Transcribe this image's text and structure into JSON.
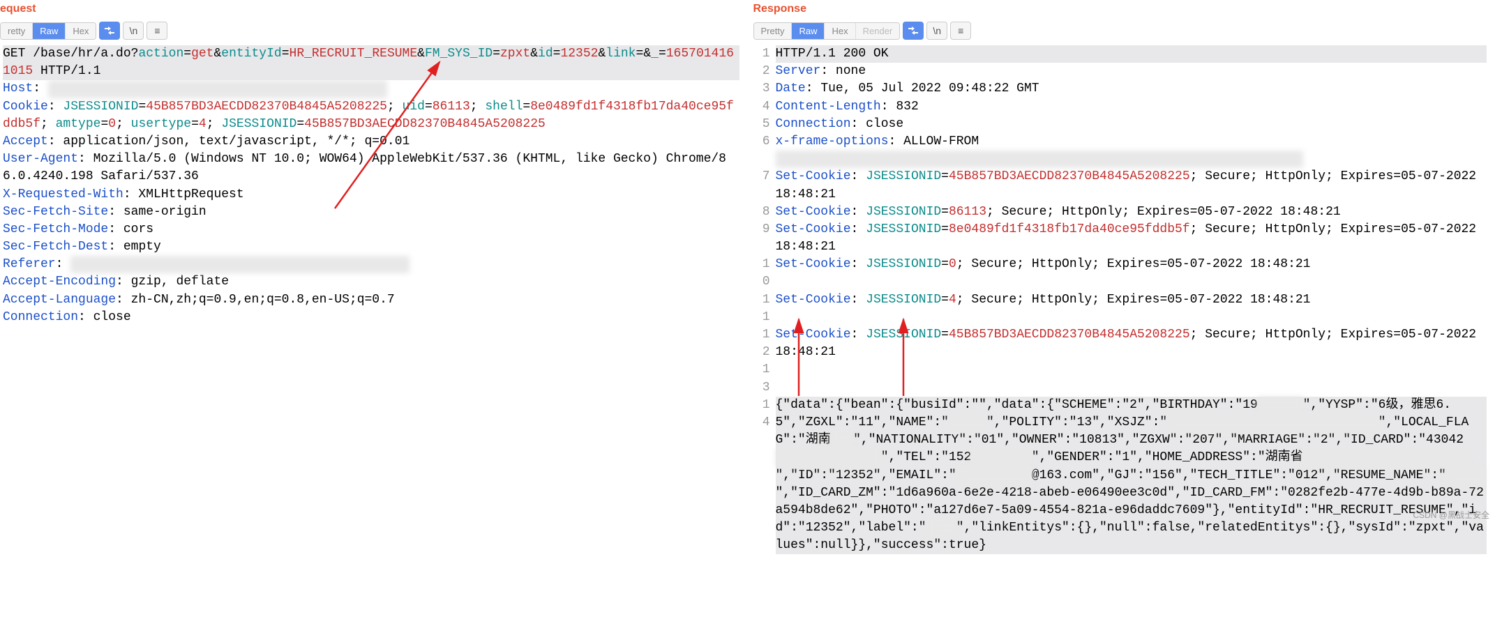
{
  "left": {
    "title": "equest",
    "tabs": [
      "retty",
      "Raw",
      "Hex"
    ],
    "activeTab": 1,
    "iconButtons": [
      "format",
      "newline",
      "menu"
    ],
    "request": {
      "method": "GET",
      "path": "/base/hr/a.do",
      "qmark": "?",
      "params": [
        {
          "k": "action",
          "v": "get"
        },
        {
          "k": "entityId",
          "v": "HR_RECRUIT_RESUME"
        },
        {
          "k": "FM_SYS_ID",
          "v": "zpxt"
        },
        {
          "k": "id",
          "v": "12352"
        },
        {
          "k": "link",
          "v": ""
        },
        {
          "k": "_",
          "v": "1657014161015"
        }
      ],
      "protocol": "HTTP/1.1",
      "headers": [
        {
          "name": "Host",
          "value": "",
          "redacted": true
        },
        {
          "name": "Cookie",
          "cookiePairs": [
            {
              "k": "JSESSIONID",
              "v": "45B857BD3AECDD82370B4845A5208225"
            },
            {
              "k": "uid",
              "v": "86113"
            },
            {
              "k": "shell",
              "v": "8e0489fd1f4318fb17da40ce95fddb5f"
            },
            {
              "k": "amtype",
              "v": "0"
            },
            {
              "k": "usertype",
              "v": "4"
            },
            {
              "k": "JSESSIONID",
              "v": "45B857BD3AECDD82370B4845A5208225"
            }
          ]
        },
        {
          "name": "Accept",
          "value": "application/json, text/javascript, */*; q=0.01"
        },
        {
          "name": "User-Agent",
          "value": "Mozilla/5.0 (Windows NT 10.0; WOW64) AppleWebKit/537.36 (KHTML, like Gecko) Chrome/86.0.4240.198 Safari/537.36"
        },
        {
          "name": "X-Requested-With",
          "value": "XMLHttpRequest"
        },
        {
          "name": "Sec-Fetch-Site",
          "value": "same-origin"
        },
        {
          "name": "Sec-Fetch-Mode",
          "value": "cors"
        },
        {
          "name": "Sec-Fetch-Dest",
          "value": "empty"
        },
        {
          "name": "Referer",
          "value": "",
          "redacted": true
        },
        {
          "name": "Accept-Encoding",
          "value": "gzip, deflate"
        },
        {
          "name": "Accept-Language",
          "value": "zh-CN,zh;q=0.9,en;q=0.8,en-US;q=0.7"
        },
        {
          "name": "Connection",
          "value": "close"
        }
      ]
    }
  },
  "right": {
    "title": "Response",
    "tabs": [
      "Pretty",
      "Raw",
      "Hex",
      "Render"
    ],
    "activeTab": 1,
    "iconButtons": [
      "format",
      "newline",
      "menu"
    ],
    "lines": [
      {
        "n": 1,
        "segments": [
          {
            "t": "HTTP/1.1 200 OK"
          }
        ],
        "hl": true
      },
      {
        "n": 2,
        "segments": [
          {
            "t": "Server",
            "c": "blue"
          },
          {
            "t": ": none"
          }
        ]
      },
      {
        "n": 3,
        "segments": [
          {
            "t": "Date",
            "c": "blue"
          },
          {
            "t": ": Tue, 05 Jul 2022 09:48:22 GMT"
          }
        ]
      },
      {
        "n": 4,
        "segments": [
          {
            "t": "Content-Length",
            "c": "blue"
          },
          {
            "t": ": 832"
          }
        ]
      },
      {
        "n": 5,
        "segments": [
          {
            "t": "Connection",
            "c": "blue"
          },
          {
            "t": ": close"
          }
        ]
      },
      {
        "n": 6,
        "segments": [
          {
            "t": "x-frame-options",
            "c": "blue"
          },
          {
            "t": ": ALLOW-FROM "
          },
          {
            "t": "xxxxxxxxxxxxxxxxxxxxxxxxxxxxxxxxxxxxxxxxxxxxxxxxxxxxxxxxxxxxxxxxxxxxxx",
            "redact": true
          }
        ]
      },
      {
        "n": 7,
        "segments": [
          {
            "t": "Set-Cookie",
            "c": "blue"
          },
          {
            "t": ": "
          },
          {
            "t": "JSESSIONID",
            "c": "teal"
          },
          {
            "t": "="
          },
          {
            "t": "45B857BD3AECDD82370B4845A5208225",
            "c": "red"
          },
          {
            "t": "; Secure; HttpOnly; Expires=05-07-2022 18:48:21"
          }
        ]
      },
      {
        "n": 8,
        "segments": [
          {
            "t": "Set-Cookie",
            "c": "blue"
          },
          {
            "t": ": "
          },
          {
            "t": "JSESSIONID",
            "c": "teal"
          },
          {
            "t": "="
          },
          {
            "t": "86113",
            "c": "red"
          },
          {
            "t": "; Secure; HttpOnly; Expires=05-07-2022 18:48:21"
          }
        ]
      },
      {
        "n": 9,
        "segments": [
          {
            "t": "Set-Cookie",
            "c": "blue"
          },
          {
            "t": ": "
          },
          {
            "t": "JSESSIONID",
            "c": "teal"
          },
          {
            "t": "="
          },
          {
            "t": "8e0489fd1f4318fb17da40ce95fddb5f",
            "c": "red"
          },
          {
            "t": "; Secure; HttpOnly; Expires=05-07-2022 18:48:21"
          }
        ]
      },
      {
        "n": 10,
        "segments": [
          {
            "t": "Set-Cookie",
            "c": "blue"
          },
          {
            "t": ": "
          },
          {
            "t": "JSESSIONID",
            "c": "teal"
          },
          {
            "t": "="
          },
          {
            "t": "0",
            "c": "red"
          },
          {
            "t": "; Secure; HttpOnly; Expires=05-07-2022 18:48:21"
          }
        ]
      },
      {
        "n": 11,
        "segments": [
          {
            "t": "Set-Cookie",
            "c": "blue"
          },
          {
            "t": ": "
          },
          {
            "t": "JSESSIONID",
            "c": "teal"
          },
          {
            "t": "="
          },
          {
            "t": "4",
            "c": "red"
          },
          {
            "t": "; Secure; HttpOnly; Expires=05-07-2022 18:48:21"
          }
        ]
      },
      {
        "n": 12,
        "segments": [
          {
            "t": "Set-Cookie",
            "c": "blue"
          },
          {
            "t": ": "
          },
          {
            "t": "JSESSIONID",
            "c": "teal"
          },
          {
            "t": "="
          },
          {
            "t": "45B857BD3AECDD82370B4845A5208225",
            "c": "red"
          },
          {
            "t": "; Secure; HttpOnly; Expires=05-07-2022 18:48:21"
          }
        ]
      },
      {
        "n": 13,
        "segments": [
          {
            "t": ""
          }
        ]
      },
      {
        "n": 14,
        "segments": [
          {
            "t": "{\"data\":{\"bean\":{\"busiId\":\"\",\"data\":{\"SCHEME\":\"2\",\"BIRTHDAY\":\"19"
          },
          {
            "t": "xxxxxx",
            "redact": true
          },
          {
            "t": "\",\"YYSP\":\"6级，雅思6.5\",\"ZGXL\":\"11\",\"NAME\":\""
          },
          {
            "t": "xxxxx",
            "redact": true
          },
          {
            "t": "\",\"POLITY\":\"13\",\"XSJZ\":\""
          },
          {
            "t": "xxxxxxxxxxxxxxxxxxxxxxxxxxxx",
            "redact": true
          },
          {
            "t": "\",\"LOCAL_FLAG\":\"湖南"
          },
          {
            "t": "xxx",
            "redact": true
          },
          {
            "t": "\",\"NATIONALITY\":\"01\",\"OWNER\":\"10813\",\"ZGXW\":\"207\",\"MARRIAGE\":\"2\",\"ID_CARD\":\"43042"
          },
          {
            "t": "xxxxxxxxxxxxxx",
            "redact": true
          },
          {
            "t": "\",\"TEL\":\"152"
          },
          {
            "t": "xxxxxxxx",
            "redact": true
          },
          {
            "t": "\",\"GENDER\":\"1\",\"HOME_ADDRESS\":\"湖南省"
          },
          {
            "t": "xxxxxxxxxxxxxxxxxxxxxx",
            "redact": true
          },
          {
            "t": "\",\"ID\":\"12352\",\"EMAIL\":\""
          },
          {
            "t": "xxxxxxxxxx",
            "redact": true
          },
          {
            "t": "@163.com\",\"GJ\":\"156\",\"TECH_TITLE\":\"012\",\"RESUME_NAME\":\""
          },
          {
            "t": "xxxxx",
            "redact": true
          },
          {
            "t": "\",\"ID_CARD_ZM\":\"1d6a960a-6e2e-4218-abeb-e06490ee3c0d\",\"ID_CARD_FM\":\"0282fe2b-477e-4d9b-b89a-72a594b8de62\",\"PHOTO\":\"a127d6e7-5a09-4554-821a-e96daddc7609\"},\"entityId\":\"HR_RECRUIT_RESUME\",\"id\":\"12352\",\"label\":\""
          },
          {
            "t": "xxxx",
            "redact": true
          },
          {
            "t": "\",\"linkEntitys\":{},\"null\":false,\"relatedEntitys\":{},\"sysId\":\"zpxt\",\"values\":null}},\"success\":true}"
          }
        ],
        "hl": true
      }
    ]
  },
  "watermark": "CSDN @黑战士安全"
}
